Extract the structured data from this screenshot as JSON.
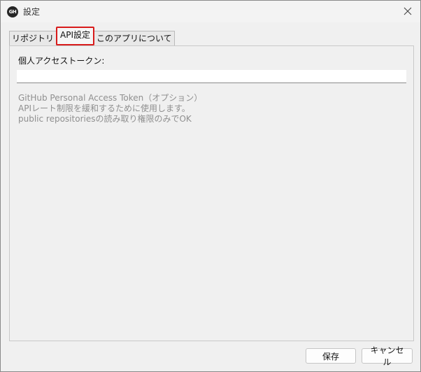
{
  "window": {
    "app_icon_text": "GH",
    "title": "設定"
  },
  "tabs": [
    {
      "label": "リポジトリ"
    },
    {
      "label": "API設定",
      "active": true
    },
    {
      "label": "このアプリについて"
    }
  ],
  "panel": {
    "token_label": "個人アクセストークン:",
    "token_value": "",
    "help_lines": [
      "GitHub Personal Access Token（オプション）",
      "APIレート制限を緩和するために使用します。",
      "public repositoriesの読み取り権限のみでOK"
    ]
  },
  "buttons": {
    "save": "保存",
    "cancel": "キャンセル"
  },
  "colors": {
    "active_tab_border": "#d81b1b",
    "help_text": "#8f8f8f",
    "background": "#f0f0f0"
  }
}
